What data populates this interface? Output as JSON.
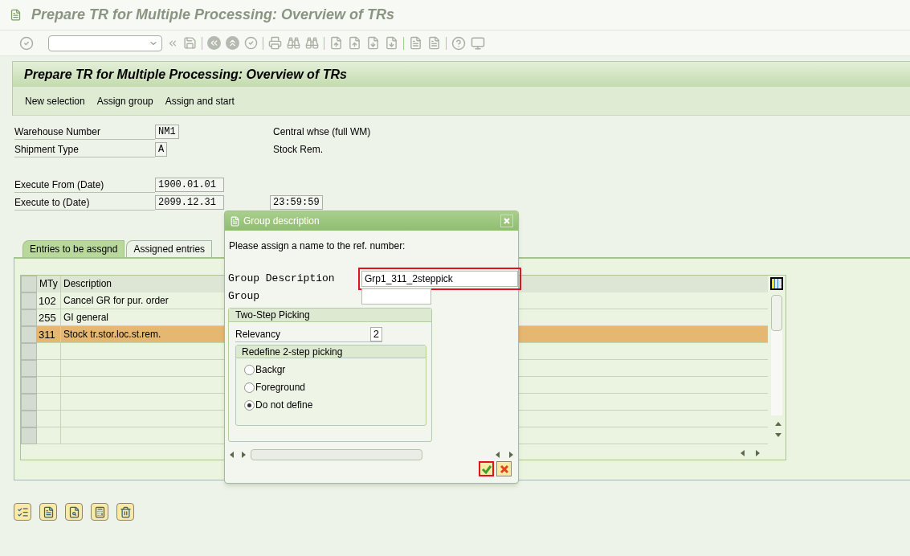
{
  "window": {
    "title": "Prepare TR for Multiple Processing: Overview of TRs"
  },
  "screen": {
    "title": "Prepare TR for Multiple Processing: Overview of TRs",
    "actions": [
      "New selection",
      "Assign group",
      "Assign and start"
    ]
  },
  "form": {
    "rows": [
      {
        "label": "Warehouse Number",
        "value": "NM1",
        "description": "Central whse (full WM)"
      },
      {
        "label": "Shipment Type",
        "value": "A",
        "description": "Stock Rem."
      },
      {
        "label": "Execute From (Date)",
        "value": "1900.01.01"
      },
      {
        "label": "Execute to (Date)",
        "value": "2099.12.31",
        "time": "23:59:59"
      }
    ]
  },
  "tabs": [
    {
      "label": "Entries to be assgnd",
      "selected": true
    },
    {
      "label": "Assigned entries",
      "selected": false
    }
  ],
  "table": {
    "columns": [
      "MTy",
      "Description"
    ],
    "rows": [
      {
        "mty": "102",
        "description": "Cancel GR for pur. order",
        "selected": false
      },
      {
        "mty": "255",
        "description": "GI general",
        "selected": false
      },
      {
        "mty": "311",
        "description": "Stock tr.stor.loc.st.rem.",
        "selected": true
      }
    ]
  },
  "dialog": {
    "title": "Group description",
    "prompt": "Please assign a name to the ref. number:",
    "fields": [
      {
        "label": "Group Description",
        "value": "Grp1_311_2steppick",
        "highlighted": true
      },
      {
        "label": "Group",
        "highlighted": false
      }
    ],
    "group": {
      "title": "Two-Step Picking",
      "relevancy": {
        "label": "Relevancy",
        "value": "2"
      },
      "subgroup": {
        "title": "Redefine 2-step picking",
        "options": [
          {
            "label": "Backgr",
            "selected": false
          },
          {
            "label": "Foreground",
            "selected": false
          },
          {
            "label": "Do not define",
            "selected": true
          }
        ]
      }
    },
    "buttons": [
      {
        "kind": "confirm",
        "highlighted": true
      },
      {
        "kind": "cancel",
        "highlighted": false
      }
    ]
  }
}
